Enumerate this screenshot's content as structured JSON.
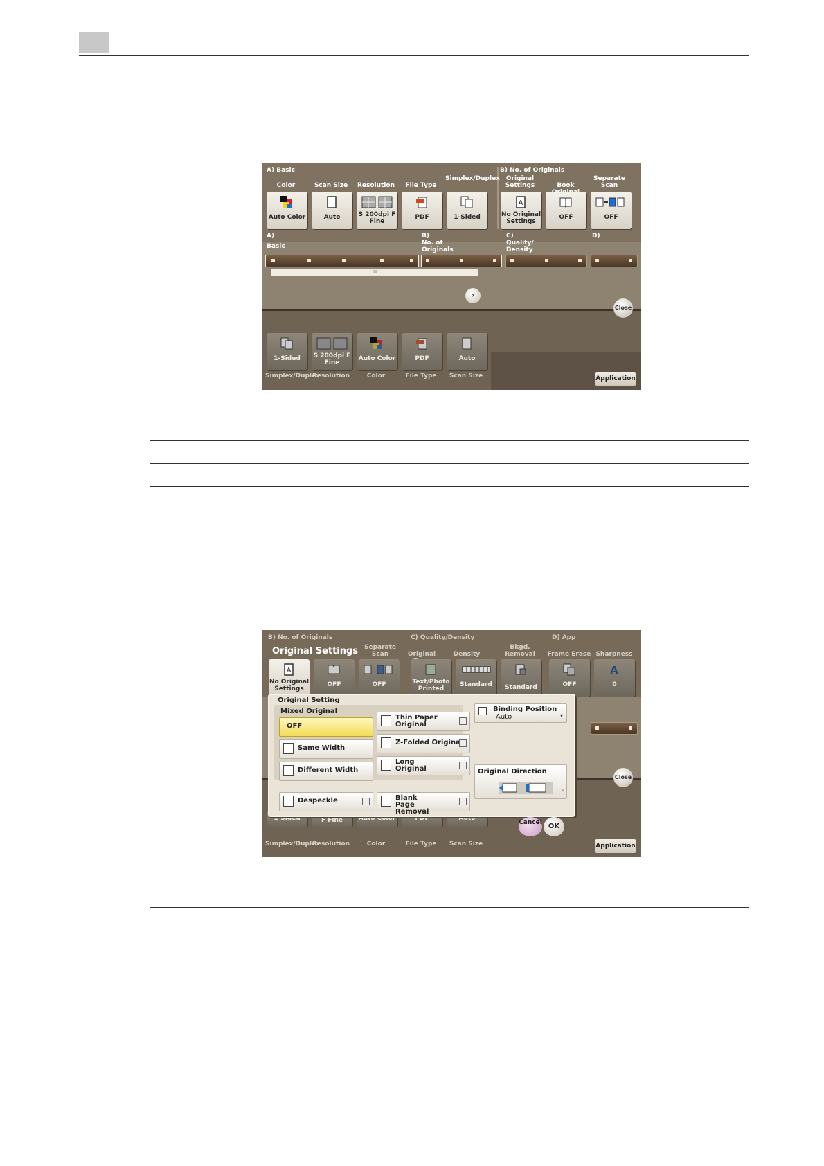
{
  "panel1": {
    "group_a": "A)  Basic",
    "group_b": "B)  No. of Originals",
    "top_buttons": [
      {
        "caption": "Color",
        "value": "Auto Color",
        "icon": "color-mode-icon"
      },
      {
        "caption": "Scan Size",
        "value": "Auto",
        "icon": "page-icon"
      },
      {
        "caption": "Resolution",
        "value": "S 200dpi F Fine",
        "icon": "resolution-icon"
      },
      {
        "caption": "File Type",
        "value": "PDF",
        "icon": "pdf-file-icon"
      },
      {
        "caption": "Simplex/Duplex",
        "value": "1-Sided",
        "icon": "simplex-icon"
      },
      {
        "caption": "Original Settings",
        "value": "No Original Settings",
        "icon": "original-a-icon"
      },
      {
        "caption": "Book Original",
        "value": "OFF",
        "icon": "book-icon"
      },
      {
        "caption": "Separate Scan",
        "value": "OFF",
        "icon": "separate-scan-icon"
      }
    ],
    "tabs": [
      {
        "letter": "A)",
        "label": "Basic"
      },
      {
        "letter": "B)",
        "label": "No. of Originals"
      },
      {
        "letter": "C)",
        "label": "Quality/ Density"
      },
      {
        "letter": "D)",
        "label": ""
      }
    ],
    "scroll_mark": "III",
    "close_label": "Close",
    "bottom_buttons": [
      {
        "value": "1-Sided",
        "caption": "Simplex/Duplex"
      },
      {
        "value": "S 200dpi F Fine",
        "caption": "Resolution"
      },
      {
        "value": "Auto Color",
        "caption": "Color"
      },
      {
        "value": "PDF",
        "caption": "File Type"
      },
      {
        "value": "Auto",
        "caption": "Scan Size"
      }
    ],
    "application_label": "Application"
  },
  "panel2": {
    "group_b": "B)  No. of Originals",
    "group_c": "C)  Quality/Density",
    "group_d": "D)  App",
    "popup_title": "Original Settings",
    "top_buttons": [
      {
        "caption": "",
        "value": "No Original Settings"
      },
      {
        "caption": "",
        "value": "OFF"
      },
      {
        "caption": "Separate Scan",
        "value": "OFF"
      },
      {
        "caption": "Original Type",
        "value": "Text/Photo Printed"
      },
      {
        "caption": "Density",
        "value": "Standard"
      },
      {
        "caption": "Bkgd. Removal",
        "value": "Standard"
      },
      {
        "caption": "Frame Erase",
        "value": "OFF"
      },
      {
        "caption": "Sharpness",
        "value": "0"
      }
    ],
    "dialog": {
      "section": "Original Setting",
      "mixed_label": "Mixed Original",
      "mixed_options": [
        "OFF",
        "Same Width",
        "Different Width"
      ],
      "right_options": [
        "Thin Paper Original",
        "Z-Folded Original",
        "Long Original"
      ],
      "binding_label": "Binding Position",
      "binding_value": "Auto",
      "direction_label": "Original Direction",
      "despeckle": "Despeckle",
      "blank_page": "Blank Page Removal",
      "cancel": "Cancel",
      "ok": "OK"
    },
    "close_label": "Close",
    "bottom_captions": [
      "Simplex/Duplex",
      "Resolution",
      "Color",
      "File Type",
      "Scan Size"
    ],
    "bottom_values": [
      "1-Sided",
      "F Fine",
      "Auto Color",
      "PDF",
      "Auto"
    ],
    "application_label": "Application"
  }
}
